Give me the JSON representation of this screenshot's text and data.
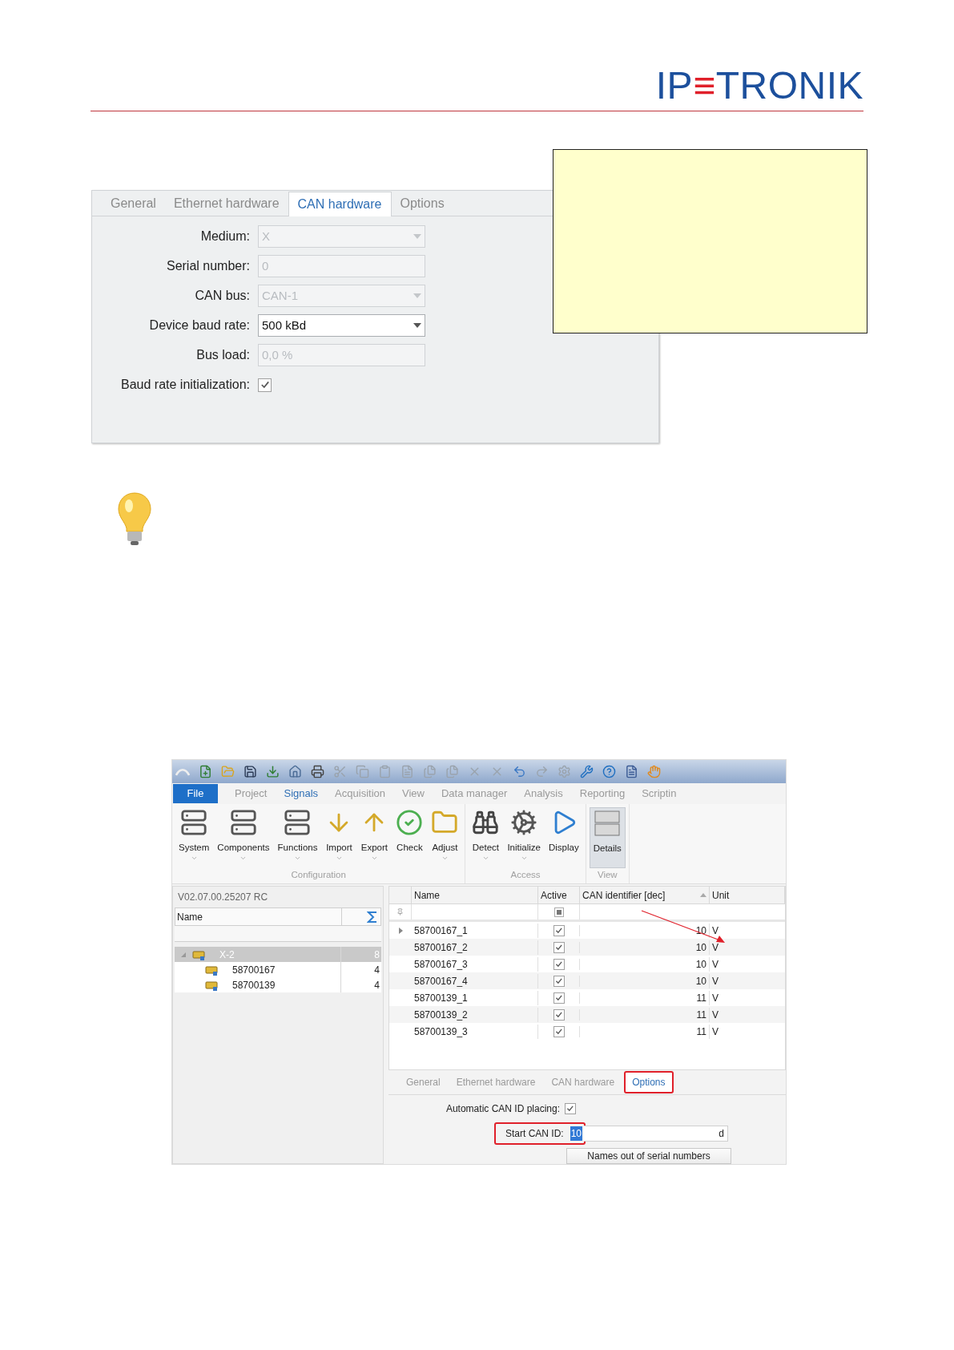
{
  "logo": {
    "prefix": "IP",
    "mark": "≡",
    "suffix": "TRONIK"
  },
  "top_dialog": {
    "tabs": [
      {
        "label": "General",
        "selected": false
      },
      {
        "label": "Ethernet hardware",
        "selected": false
      },
      {
        "label": "CAN hardware",
        "selected": true
      },
      {
        "label": "Options",
        "selected": false
      }
    ],
    "fields": [
      {
        "kind": "dropdown",
        "label": "Medium:",
        "value": "X",
        "disabled": true
      },
      {
        "kind": "text",
        "label": "Serial number:",
        "value": "0",
        "disabled": true
      },
      {
        "kind": "dropdown",
        "label": "CAN bus:",
        "value": "CAN-1",
        "disabled": true
      },
      {
        "kind": "dropdown",
        "label": "Device baud rate:",
        "value": "500 kBd",
        "disabled": false
      },
      {
        "kind": "text",
        "label": "Bus load:",
        "value": "0,0 %",
        "disabled": true
      },
      {
        "kind": "checkbox",
        "label": "Baud rate initialization:",
        "checked": true
      }
    ]
  },
  "app": {
    "ribbon_tabs": [
      {
        "label": "File",
        "kind": "file",
        "selected": false
      },
      {
        "label": "Project",
        "kind": "tab",
        "selected": false
      },
      {
        "label": "Signals",
        "kind": "tab",
        "selected": true
      },
      {
        "label": "Acquisition",
        "kind": "tab",
        "selected": false
      },
      {
        "label": "View",
        "kind": "tab",
        "selected": false
      },
      {
        "label": "Data manager",
        "kind": "tab",
        "selected": false
      },
      {
        "label": "Analysis",
        "kind": "tab",
        "selected": false
      },
      {
        "label": "Reporting",
        "kind": "tab",
        "selected": false
      },
      {
        "label": "Scriptin",
        "kind": "tab",
        "selected": false
      }
    ],
    "ribbon_groups": [
      {
        "label": "Configuration",
        "buttons": [
          {
            "label": "System",
            "dropdown": true,
            "selected": false
          },
          {
            "label": "Components",
            "dropdown": true,
            "selected": false
          },
          {
            "label": "Functions",
            "dropdown": true,
            "selected": false
          },
          {
            "label": "Import",
            "dropdown": true,
            "selected": false
          },
          {
            "label": "Export",
            "dropdown": true,
            "selected": false
          },
          {
            "label": "Check",
            "dropdown": false,
            "selected": false
          },
          {
            "label": "Adjust",
            "dropdown": true,
            "selected": false
          }
        ]
      },
      {
        "label": "Access",
        "buttons": [
          {
            "label": "Detect",
            "dropdown": true,
            "selected": false
          },
          {
            "label": "Initialize",
            "dropdown": true,
            "selected": false
          },
          {
            "label": "Display",
            "dropdown": false,
            "selected": false
          }
        ]
      },
      {
        "label": "View",
        "buttons": [
          {
            "label": "Details",
            "dropdown": false,
            "selected": true
          }
        ]
      }
    ],
    "device_tree": {
      "version": "V02.07.00.25207 RC",
      "columns": [
        "Name"
      ],
      "items": [
        {
          "name": "X-2",
          "count": "8",
          "selected": true,
          "expanded": true,
          "children": [
            {
              "name": "58700167",
              "count": "4",
              "selected": false
            },
            {
              "name": "58700139",
              "count": "4",
              "selected": false
            }
          ]
        }
      ]
    },
    "signals_grid": {
      "columns": [
        "Name",
        "Active",
        "CAN identifier [dec]",
        "Unit"
      ],
      "filter_indeterminate": true,
      "rows": [
        {
          "name": "58700167_1",
          "active": true,
          "can_id": "10",
          "unit": "V",
          "current": true
        },
        {
          "name": "58700167_2",
          "active": true,
          "can_id": "10",
          "unit": "V",
          "current": false
        },
        {
          "name": "58700167_3",
          "active": true,
          "can_id": "10",
          "unit": "V",
          "current": false
        },
        {
          "name": "58700167_4",
          "active": true,
          "can_id": "10",
          "unit": "V",
          "current": false
        },
        {
          "name": "58700139_1",
          "active": true,
          "can_id": "11",
          "unit": "V",
          "current": false
        },
        {
          "name": "58700139_2",
          "active": true,
          "can_id": "11",
          "unit": "V",
          "current": false
        },
        {
          "name": "58700139_3",
          "active": true,
          "can_id": "11",
          "unit": "V",
          "current": false
        }
      ]
    },
    "detail_tabs": [
      {
        "label": "General",
        "selected": false,
        "highlighted": false
      },
      {
        "label": "Ethernet hardware",
        "selected": false,
        "highlighted": false
      },
      {
        "label": "CAN hardware",
        "selected": false,
        "highlighted": false
      },
      {
        "label": "Options",
        "selected": true,
        "highlighted": true
      }
    ],
    "options": {
      "auto_can_id": {
        "label": "Automatic CAN ID placing:",
        "checked": true
      },
      "start_can_id": {
        "label": "Start CAN ID:",
        "value": "10",
        "unit": "d",
        "highlighted": true
      },
      "button": "Names out of serial numbers"
    }
  }
}
